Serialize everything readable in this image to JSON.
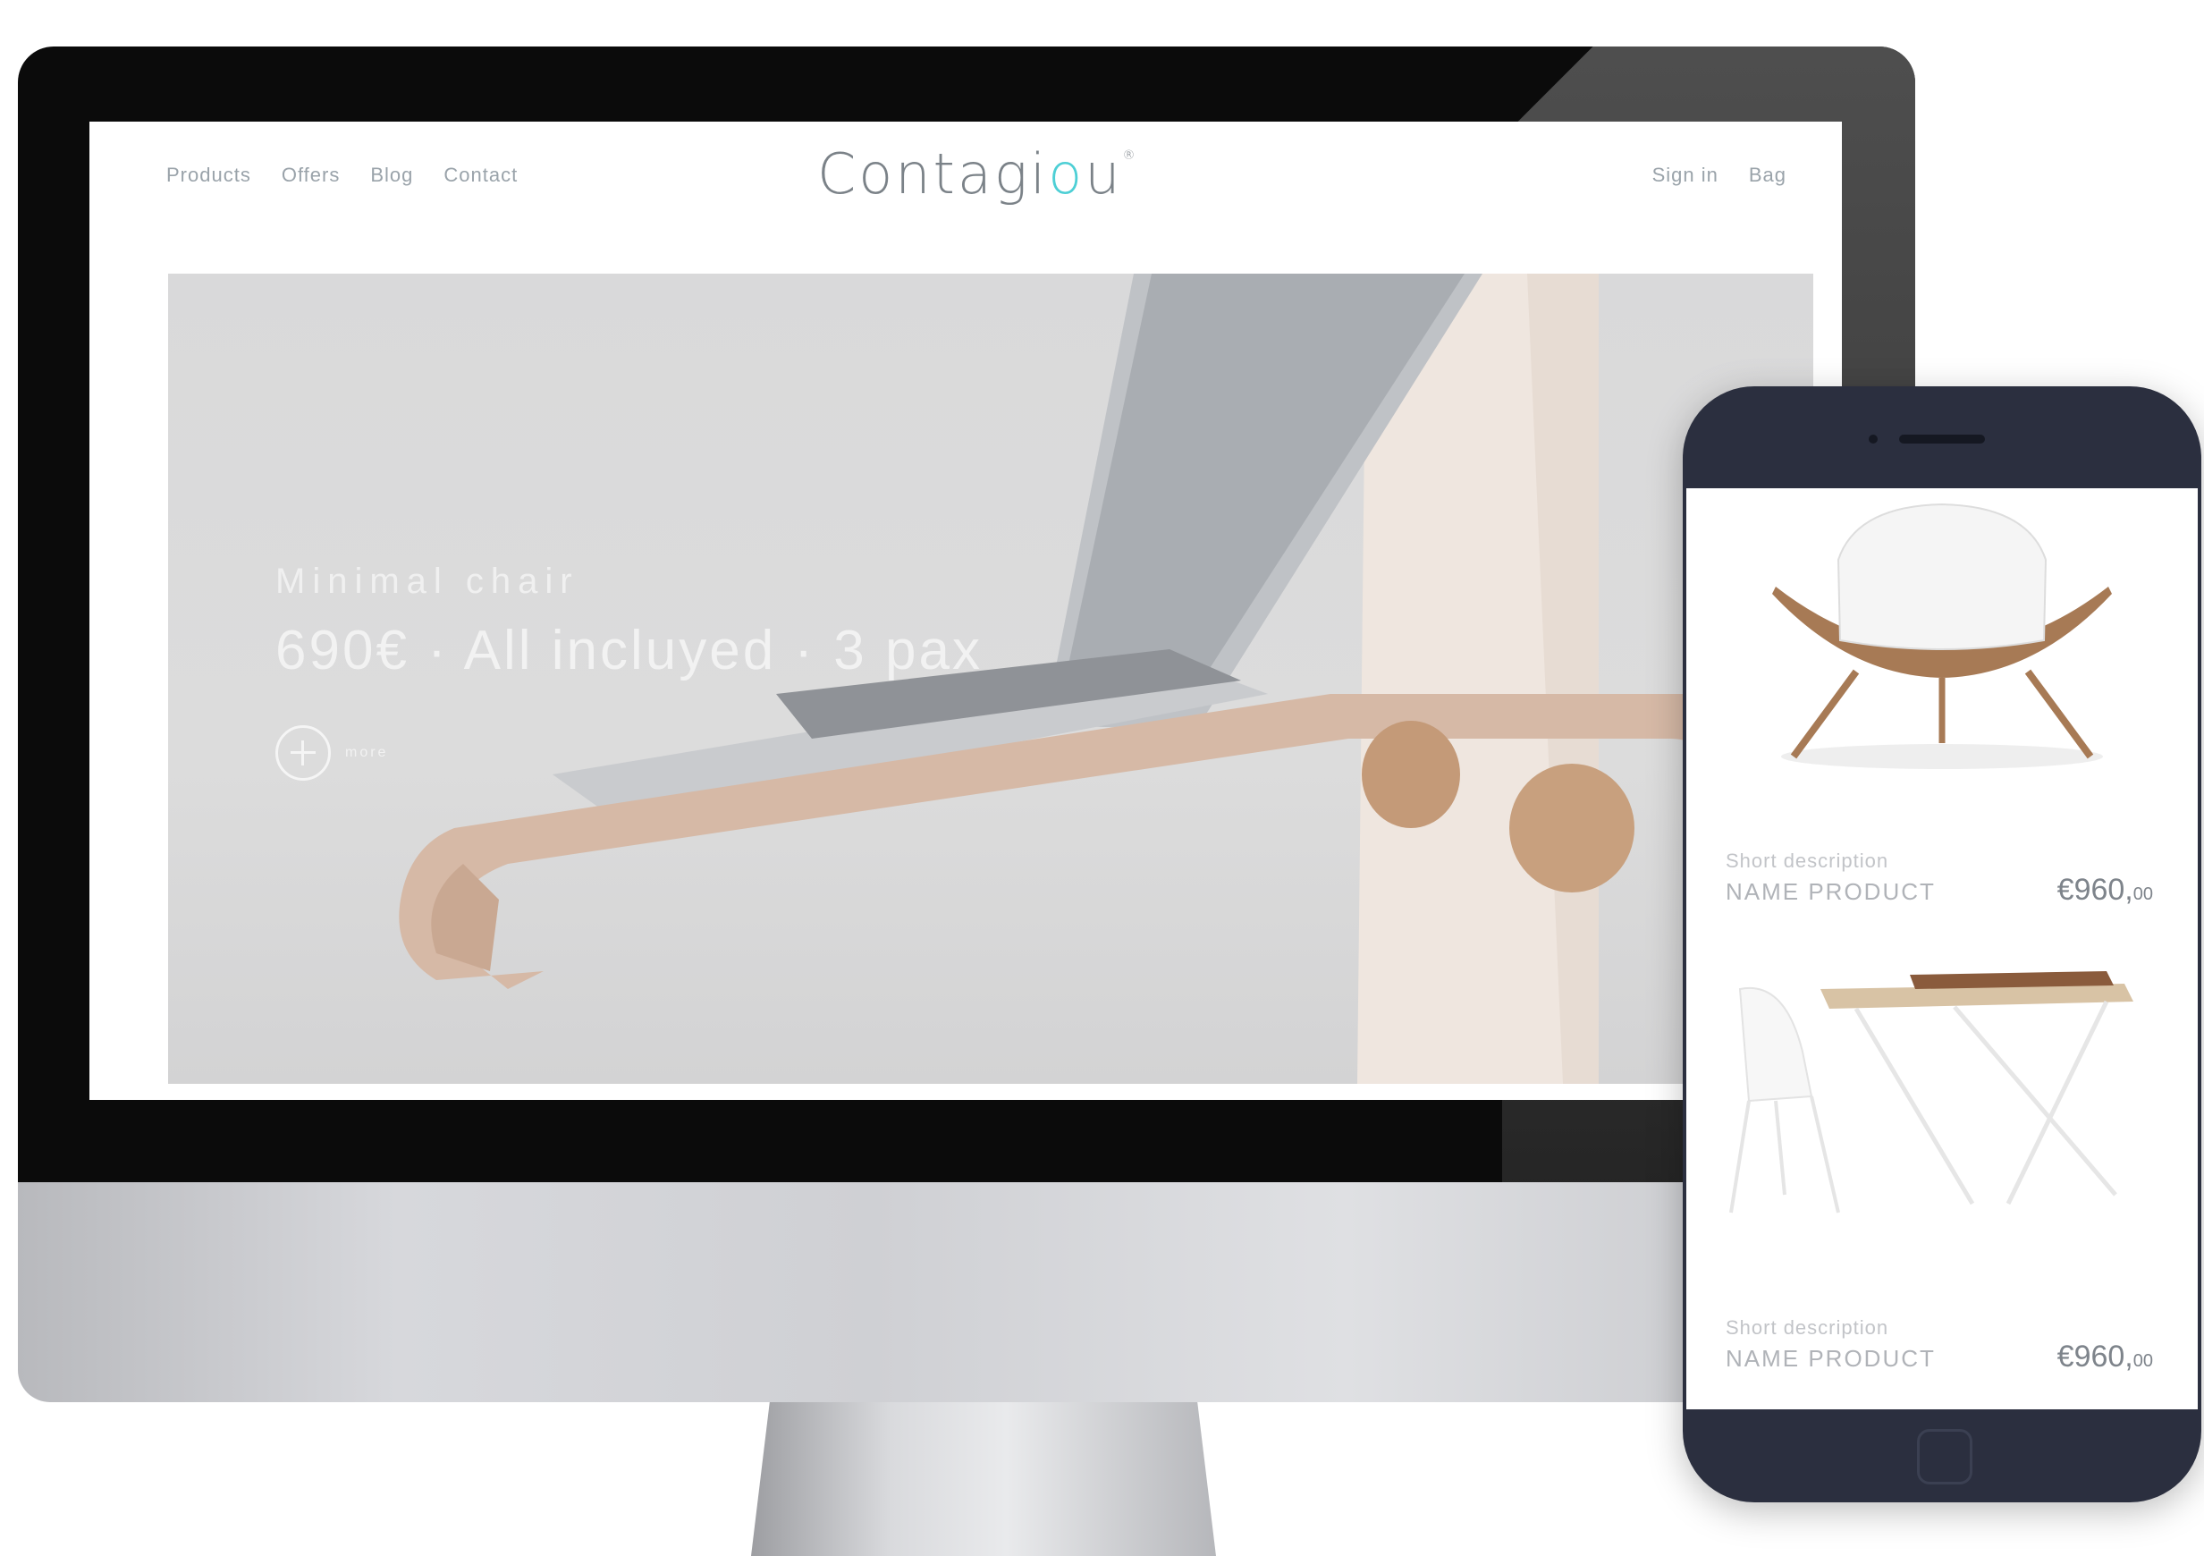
{
  "colors": {
    "brand_accent": "#4dcfd5",
    "phone_body": "#2b2f3f",
    "hero_bg": "#d9d9da"
  },
  "desktop": {
    "nav": {
      "left": [
        "Products",
        "Offers",
        "Blog",
        "Contact"
      ],
      "right": [
        "Sign in",
        "Bag"
      ]
    },
    "logo": {
      "text_before": "Contagi",
      "text_accent": "o",
      "text_after": "u",
      "mark": "®"
    },
    "hero": {
      "title": "Minimal chair",
      "subtitle": "690€ · All incluyed · 3 pax",
      "more_label": "more",
      "more_icon": "plus-circle-icon"
    }
  },
  "mobile": {
    "products": [
      {
        "description": "Short description",
        "name": "NAME PRODUCT",
        "price_main": "€960,",
        "price_cents": "00",
        "image": "shell-chair"
      },
      {
        "description": "Short description",
        "name": "NAME PRODUCT",
        "price_main": "€960,",
        "price_cents": "00",
        "image": "desk-and-chair"
      }
    ]
  }
}
